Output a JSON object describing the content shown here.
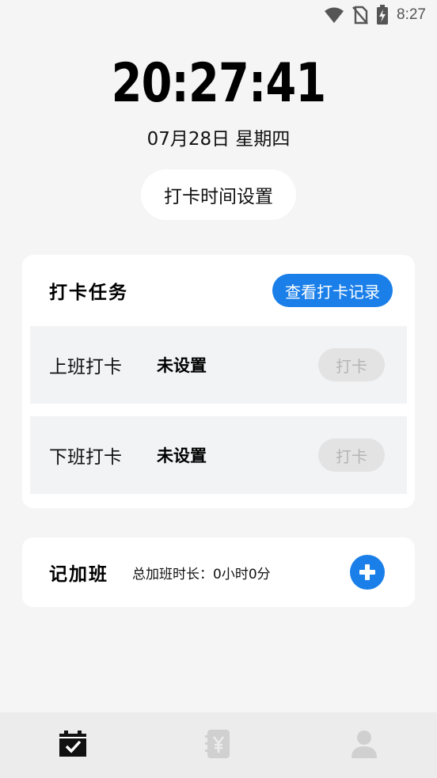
{
  "status_bar": {
    "time": "8:27",
    "icons": [
      "wifi-icon",
      "no-sim-icon",
      "battery-charging-icon"
    ]
  },
  "clock": {
    "time": "20:27:41",
    "date": "07月28日 星期四"
  },
  "settings_button": "打卡时间设置",
  "task_card": {
    "title": "打卡任务",
    "records_button": "查看打卡记录",
    "rows": [
      {
        "name": "上班打卡",
        "status": "未设置",
        "button": "打卡"
      },
      {
        "name": "下班打卡",
        "status": "未设置",
        "button": "打卡"
      }
    ]
  },
  "overtime_card": {
    "title": "记加班",
    "total": "总加班时长：0小时0分",
    "add_icon": "plus-circle-icon"
  },
  "bottom_nav": {
    "items": [
      {
        "icon": "calendar-check-icon",
        "active": true
      },
      {
        "icon": "yen-document-icon",
        "active": false
      },
      {
        "icon": "user-icon",
        "active": false
      }
    ]
  },
  "colors": {
    "accent": "#1a7fe9",
    "background": "#f5f5f5",
    "row_background": "#f2f3f5",
    "disabled": "#e3e3e3",
    "nav_inactive": "#d0d0d0"
  }
}
